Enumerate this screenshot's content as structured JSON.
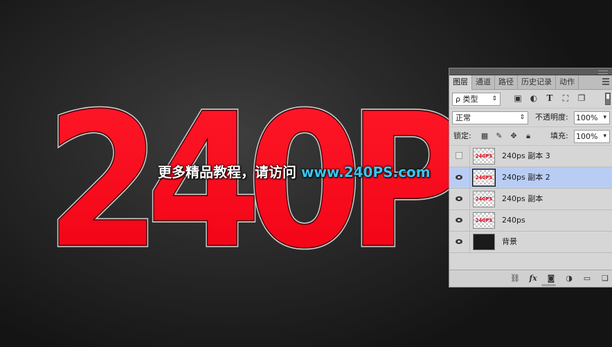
{
  "canvas": {
    "artwork_text": "240P",
    "watermark_text": "更多精品教程，请访问",
    "watermark_url": "www.240PS.com",
    "colors": {
      "text_red": "#ff0013",
      "watermark_url": "#38c6f0"
    }
  },
  "panel": {
    "tabs": [
      "图层",
      "通道",
      "路径",
      "历史记录",
      "动作"
    ],
    "filter": {
      "label": "ρ 类型",
      "icons": [
        "image-filter-icon",
        "adjustment-filter-icon",
        "type-filter-icon",
        "shape-filter-icon",
        "smart-object-filter-icon"
      ]
    },
    "blend_mode": "正常",
    "opacity_label": "不透明度:",
    "opacity_value": "100%",
    "lock_label": "锁定:",
    "fill_label": "填充:",
    "fill_value": "100%",
    "layers": [
      {
        "name": "240ps  副本 3",
        "visible": false,
        "selected": false,
        "thumb": "240PS"
      },
      {
        "name": "240ps  副本 2",
        "visible": true,
        "selected": true,
        "thumb": "240PS"
      },
      {
        "name": "240ps  副本",
        "visible": true,
        "selected": false,
        "thumb": "240PS"
      },
      {
        "name": "240ps",
        "visible": true,
        "selected": false,
        "thumb": "240PS"
      },
      {
        "name": "背景",
        "visible": true,
        "selected": false,
        "thumb": ""
      }
    ],
    "footer_icons": [
      "link-layers-icon",
      "fx-icon",
      "add-mask-icon",
      "new-adjustment-icon",
      "new-group-icon",
      "new-layer-icon"
    ]
  }
}
